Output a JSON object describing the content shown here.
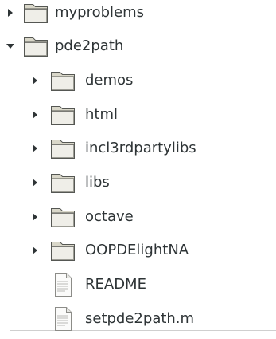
{
  "tree": {
    "items": [
      {
        "label": "myproblems",
        "type": "folder",
        "expanded": false,
        "level": 0
      },
      {
        "label": "pde2path",
        "type": "folder",
        "expanded": true,
        "level": 0
      },
      {
        "label": "demos",
        "type": "folder",
        "expanded": false,
        "level": 1
      },
      {
        "label": "html",
        "type": "folder",
        "expanded": false,
        "level": 1
      },
      {
        "label": "incl3rdpartylibs",
        "type": "folder",
        "expanded": false,
        "level": 1
      },
      {
        "label": "libs",
        "type": "folder",
        "expanded": false,
        "level": 1
      },
      {
        "label": "octave",
        "type": "folder",
        "expanded": false,
        "level": 1
      },
      {
        "label": "OOPDElightNA",
        "type": "folder",
        "expanded": false,
        "level": 1
      },
      {
        "label": "README",
        "type": "file",
        "level": 1
      },
      {
        "label": "setpde2path.m",
        "type": "file",
        "level": 1
      }
    ]
  },
  "icons": {
    "folder": "folder-icon",
    "file": "text-file-icon",
    "collapsed": "triangle-right-icon",
    "expanded": "triangle-down-icon"
  },
  "colors": {
    "text": "#2e3436",
    "expander": "#2e3436",
    "folder_body": "#d9d7c9",
    "folder_outline": "#555753"
  }
}
